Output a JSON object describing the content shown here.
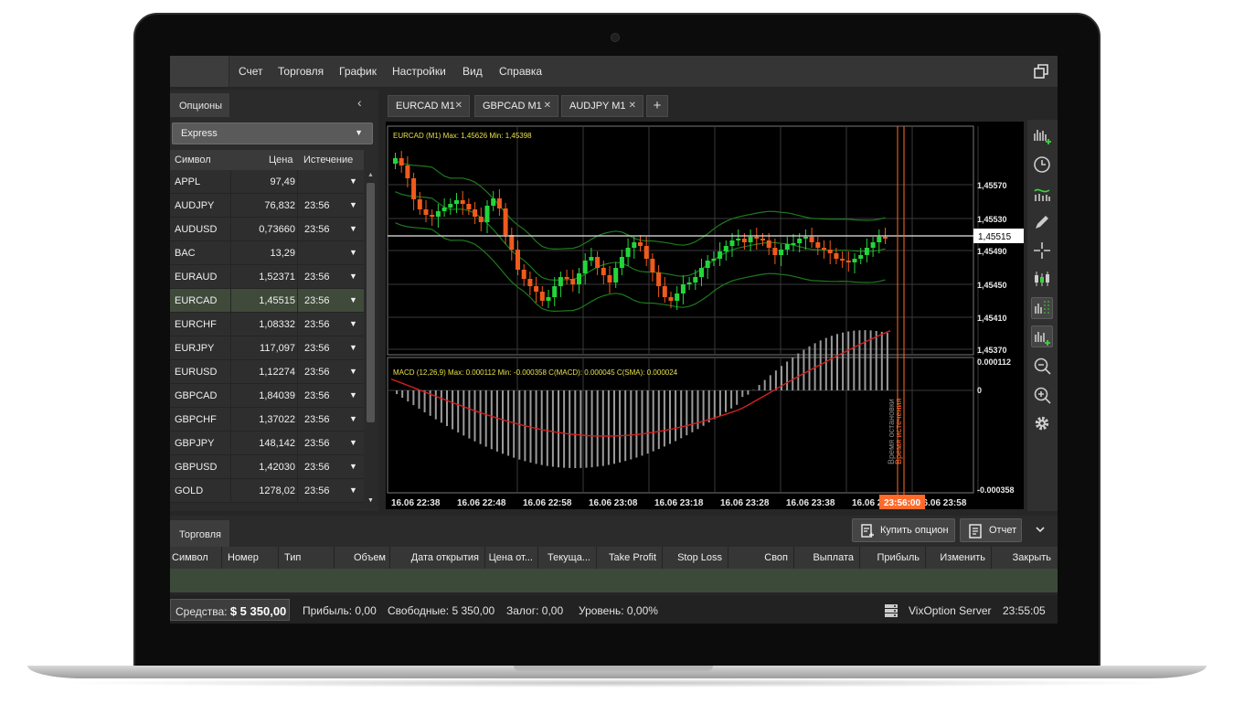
{
  "menu": {
    "items": [
      "Счет",
      "Торговля",
      "График",
      "Настройки",
      "Вид",
      "Справка"
    ]
  },
  "left_panel": {
    "tab_label": "Опционы",
    "selector_value": "Express",
    "columns": [
      "Символ",
      "Цена",
      "Истечение"
    ],
    "rows": [
      {
        "symbol": "APPL",
        "price": "97,49",
        "expiry": ""
      },
      {
        "symbol": "AUDJPY",
        "price": "76,832",
        "expiry": "23:56"
      },
      {
        "symbol": "AUDUSD",
        "price": "0,73660",
        "expiry": "23:56"
      },
      {
        "symbol": "BAC",
        "price": "13,29",
        "expiry": ""
      },
      {
        "symbol": "EURAUD",
        "price": "1,52371",
        "expiry": "23:56"
      },
      {
        "symbol": "EURCAD",
        "price": "1,45515",
        "expiry": "23:56"
      },
      {
        "symbol": "EURCHF",
        "price": "1,08332",
        "expiry": "23:56"
      },
      {
        "symbol": "EURJPY",
        "price": "117,097",
        "expiry": "23:56"
      },
      {
        "symbol": "EURUSD",
        "price": "1,12274",
        "expiry": "23:56"
      },
      {
        "symbol": "GBPCAD",
        "price": "1,84039",
        "expiry": "23:56"
      },
      {
        "symbol": "GBPCHF",
        "price": "1,37022",
        "expiry": "23:56"
      },
      {
        "symbol": "GBPJPY",
        "price": "148,142",
        "expiry": "23:56"
      },
      {
        "symbol": "GBPUSD",
        "price": "1,42030",
        "expiry": "23:56"
      },
      {
        "symbol": "GOLD",
        "price": "1278,02",
        "expiry": "23:56"
      }
    ],
    "selected_symbol": "EURCAD"
  },
  "chart_tabs": [
    {
      "label": "EURCAD M1"
    },
    {
      "label": "GBPCAD M1"
    },
    {
      "label": "AUDJPY M1"
    }
  ],
  "chart": {
    "price_header": "EURCAD (M1)  Max: 1,45626  Min: 1,45398",
    "macd_header": "MACD (12,26,9)  Max: 0.000112  Min: -0.000358  C(MACD): 0.000045  C(SMA): 0.000024",
    "price_ticks": [
      "1,45570",
      "1,45530",
      "1,45490",
      "1,45450",
      "1,45410",
      "1,45370"
    ],
    "current_price": "1,45515",
    "macd_ticks": [
      "0.000112",
      "0",
      "-0.000358"
    ],
    "time_ticks": [
      "16.06 22:38",
      "16.06 22:48",
      "16.06 22:58",
      "16.06 23:08",
      "16.06 23:18",
      "16.06 23:28",
      "16.06 23:38",
      "16.06 2",
      "16.06 23:58"
    ],
    "current_time": "23:56:00",
    "marker_label_stop": "Время остановки",
    "marker_label_expiry": "Время истечения",
    "colors": {
      "up": "#22d63a",
      "down": "#f05a1c",
      "bands": "#1e7a1e",
      "macd_signal": "#d42020",
      "macd_hist": "#9a9a9a",
      "marker": "#ff6a2a",
      "header_text": "#e6e04a"
    }
  },
  "toolbar_icons": [
    "bar-chart-add-icon",
    "clock-icon",
    "indicators-icon",
    "pencil-icon",
    "crosshair-icon",
    "candles-icon",
    "chart-grid-icon",
    "chart-add-icon",
    "zoom-out-icon",
    "zoom-in-icon",
    "settings-icon"
  ],
  "bottom": {
    "tab_label": "Торговля",
    "buy_button": "Купить опцион",
    "report_button": "Отчет",
    "columns": [
      "Символ",
      "Номер",
      "Тип",
      "Объем",
      "Дата открытия",
      "Цена от...",
      "Текуща...",
      "Take Profit",
      "Stop Loss",
      "Своп",
      "Выплата",
      "Прибыль",
      "Изменить",
      "Закрыть"
    ]
  },
  "status": {
    "funds_label": "Средства:",
    "funds_value": "$ 5 350,00",
    "profit": "Прибыль: 0,00",
    "free": "Свободные: 5 350,00",
    "margin": "Залог: 0,00",
    "level": "Уровень: 0,00%",
    "server": "VixOption Server",
    "time": "23:55:05"
  }
}
